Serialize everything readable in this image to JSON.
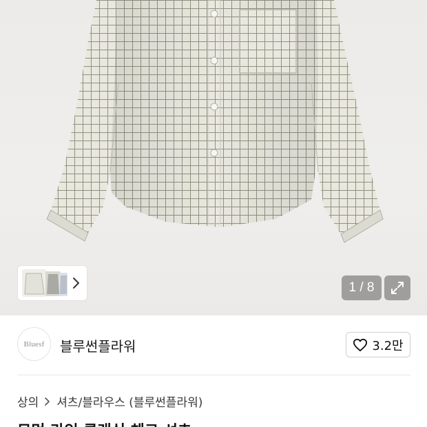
{
  "gallery": {
    "counter": "1 / 8",
    "expand_icon": "expand-arrows-icon",
    "next_icon": "chevron-right-icon"
  },
  "brand": {
    "logo_text": "Bluesf",
    "name": "블루썬플라워",
    "like_icon": "heart-outline-icon",
    "like_count": "3.2만"
  },
  "breadcrumb": {
    "level1": "상의",
    "level2": "셔츠/블라우스 (블루썬플라워)",
    "separator_icon": "chevron-right-icon"
  },
  "product": {
    "title": "모먼 라인 클래식 체크 셔츠"
  },
  "colors": {
    "shirt_base": "#e9e8e0",
    "check_line": "#8f9282",
    "badge_bg": "#6b6b6b"
  }
}
